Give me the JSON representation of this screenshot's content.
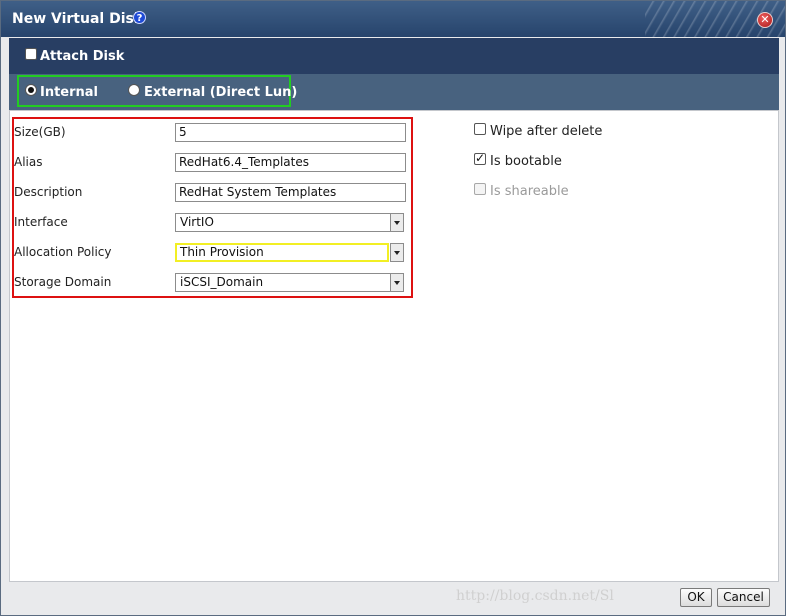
{
  "window": {
    "title": "New Virtual Disk",
    "help_icon": "help-icon",
    "close_icon": "close-icon"
  },
  "attach": {
    "label": "Attach Disk",
    "checked": false
  },
  "disk_type": {
    "options": [
      {
        "label": "Internal",
        "selected": true
      },
      {
        "label": "External (Direct Lun)",
        "selected": false
      }
    ],
    "highlight_color": "#22cc22"
  },
  "form": {
    "highlight_color": "#dd1111",
    "size": {
      "label": "Size(GB)",
      "value": "5"
    },
    "alias": {
      "label": "Alias",
      "value": "RedHat6.4_Templates"
    },
    "description": {
      "label": "Description",
      "value": "RedHat System Templates"
    },
    "interface": {
      "label": "Interface",
      "value": "VirtIO"
    },
    "allocation_policy": {
      "label": "Allocation Policy",
      "value": "Thin Provision",
      "highlight_color": "#f2ef24"
    },
    "storage_domain": {
      "label": "Storage Domain",
      "value": "iSCSI_Domain"
    }
  },
  "options": {
    "wipe_after_delete": {
      "label": "Wipe after delete",
      "checked": false
    },
    "is_bootable": {
      "label": "Is bootable",
      "checked": true
    },
    "is_shareable": {
      "label": "Is shareable",
      "checked": false,
      "disabled": true
    }
  },
  "watermark": "http://blog.csdn.net/Sl",
  "buttons": {
    "ok": "OK",
    "cancel": "Cancel"
  }
}
